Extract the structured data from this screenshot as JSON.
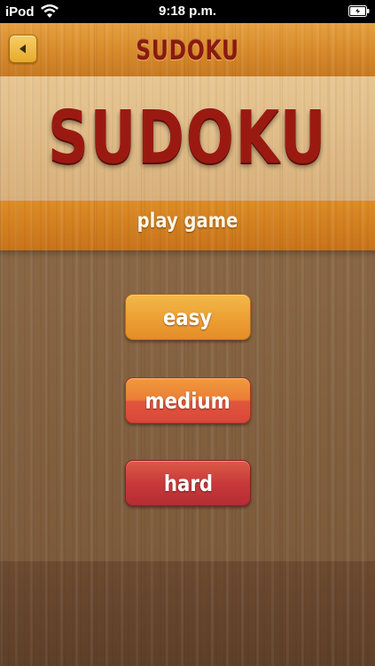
{
  "status_bar": {
    "carrier": "iPod",
    "time": "9:18 p.m.",
    "wifi_icon": "wifi-icon",
    "battery_icon": "battery-icon"
  },
  "nav": {
    "back_icon": "back-arrow-icon",
    "title": "SUDOKU"
  },
  "hero": {
    "title": "SUDOKU"
  },
  "section": {
    "label": "play game"
  },
  "difficulty": {
    "easy": "easy",
    "medium": "medium",
    "hard": "hard"
  },
  "colors": {
    "title_red": "#9a1a12",
    "nav_orange": "#d78a2b",
    "easy_orange": "#ec9f33",
    "medium_orange_red": "#e2563c",
    "hard_red": "#c83a3a"
  }
}
